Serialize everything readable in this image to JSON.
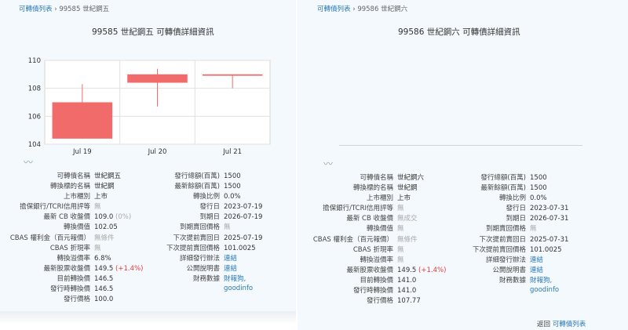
{
  "left": {
    "breadcrumb": {
      "link": "可轉債列表",
      "separator": "›",
      "current": "99585 世紀鋼五"
    },
    "title": "99585 世紀鋼五 可轉債詳細資訊",
    "chart_data": {
      "type": "candlestick",
      "categories": [
        "Jul 19",
        "Jul 20",
        "Jul 21"
      ],
      "series": [
        {
          "values": [
            {
              "open": 107.0,
              "close": 104.4,
              "high": 108.3,
              "low": 104.4
            },
            {
              "open": 108.4,
              "close": 109.0,
              "high": 109.4,
              "low": 106.7
            },
            {
              "open": 109.0,
              "close": 108.9,
              "high": 109.0,
              "low": 108.0
            }
          ]
        }
      ],
      "ylim": [
        104,
        110
      ],
      "yticks": [
        "104",
        "106",
        "108",
        "110"
      ],
      "grid": true,
      "color": "#f26b6b"
    },
    "left_rows": [
      {
        "label": "可轉債名稱",
        "value": "世紀鋼五"
      },
      {
        "label": "轉換標的名稱",
        "value": "世紀鋼"
      },
      {
        "label": "上市櫃別",
        "value": "上市"
      },
      {
        "label": "擔保銀行/TCRI信用評等",
        "value": "無"
      },
      {
        "label": "最新 CB 收盤價",
        "value": "109.0",
        "extra": "(0%)"
      },
      {
        "label": "轉換價值",
        "value": "102.05"
      },
      {
        "label": "CBAS 權利金（百元報價）",
        "value": "無條件"
      },
      {
        "label": "CBAS 折現率",
        "value": "無"
      },
      {
        "label": "轉換溢價率",
        "value": "6.8%"
      },
      {
        "label": "最新股票收盤價",
        "value": "149.5",
        "extra": "(+1.4%)"
      },
      {
        "label": "目前轉換價",
        "value": "146.5"
      },
      {
        "label": "發行時轉換價",
        "value": "146.5"
      },
      {
        "label": "發行價格",
        "value": "100.0"
      }
    ],
    "right_rows": [
      {
        "label": "發行總額(百萬)",
        "value": "1500"
      },
      {
        "label": "最新餘額(百萬)",
        "value": "1500"
      },
      {
        "label": "轉換比例",
        "value": "0.0%"
      },
      {
        "label": "發行日",
        "value": "2023-07-19"
      },
      {
        "label": "到期日",
        "value": "2026-07-19"
      },
      {
        "label": "到期賣回價格",
        "value": "無"
      },
      {
        "label": "下次提前賣回日",
        "value": "2025-07-19"
      },
      {
        "label": "下次提前賣回價格",
        "value": "101.0025"
      },
      {
        "label": "詳細發行辦法",
        "value": "連結"
      },
      {
        "label": "公開說明書",
        "value": "連結"
      },
      {
        "label": "財務數據",
        "value": "財報狗,",
        "value2": "goodinfo"
      }
    ]
  },
  "right": {
    "breadcrumb": {
      "link": "可轉債列表",
      "separator": "›",
      "current": "99586 世紀鋼六"
    },
    "title": "99586 世紀鋼六 可轉債詳細資訊",
    "left_rows": [
      {
        "label": "可轉債名稱",
        "value": "世紀鋼六"
      },
      {
        "label": "轉換標的名稱",
        "value": "世紀鋼"
      },
      {
        "label": "上市櫃別",
        "value": "上市"
      },
      {
        "label": "擔保銀行/TCRI信用評等",
        "value": "無"
      },
      {
        "label": "最新 CB 收盤價",
        "value": "無成交"
      },
      {
        "label": "轉換價值",
        "value": "無"
      },
      {
        "label": "CBAS 權利金（百元報價）",
        "value": "無條件"
      },
      {
        "label": "CBAS 折現率",
        "value": "無"
      },
      {
        "label": "轉換溢價率",
        "value": "無"
      },
      {
        "label": "最新股票收盤價",
        "value": "149.5",
        "extra": "(+1.4%)"
      },
      {
        "label": "目前轉換價",
        "value": "141.0"
      },
      {
        "label": "發行時轉換價",
        "value": "141.0"
      },
      {
        "label": "發行價格",
        "value": "107.77"
      }
    ],
    "right_rows": [
      {
        "label": "發行總額(百萬)",
        "value": "1500"
      },
      {
        "label": "最新餘額(百萬)",
        "value": "1500"
      },
      {
        "label": "轉換比例",
        "value": "0.0%"
      },
      {
        "label": "發行日",
        "value": "2023-07-31"
      },
      {
        "label": "到期日",
        "value": "2026-07-31"
      },
      {
        "label": "到期賣回價格",
        "value": "無"
      },
      {
        "label": "下次提前賣回日",
        "value": "2025-07-31"
      },
      {
        "label": "下次提前賣回價格",
        "value": "101.0025"
      },
      {
        "label": "詳細發行辦法",
        "value": "連結"
      },
      {
        "label": "公開說明書",
        "value": "連結"
      },
      {
        "label": "財務數據",
        "value": "財報狗,",
        "value2": "goodinfo"
      }
    ],
    "footer": {
      "text": "返回",
      "link": "可轉債列表"
    }
  },
  "colors": {
    "link": "#2a7ab7",
    "candle": "#f26b6b",
    "panel_bg": "#f3f9fc",
    "muted": "#aaaaaa",
    "positive": "#e03c3c"
  },
  "icons": {
    "divider": "wave-ornament-icon"
  }
}
